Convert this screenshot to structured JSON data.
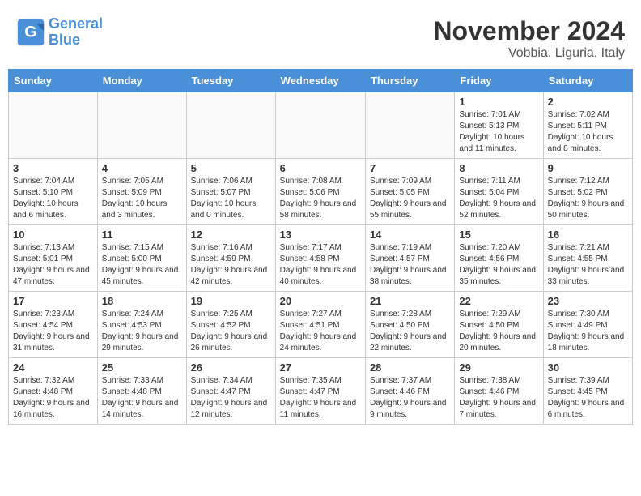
{
  "header": {
    "logo_line1": "General",
    "logo_line2": "Blue",
    "month_title": "November 2024",
    "location": "Vobbia, Liguria, Italy"
  },
  "days_of_week": [
    "Sunday",
    "Monday",
    "Tuesday",
    "Wednesday",
    "Thursday",
    "Friday",
    "Saturday"
  ],
  "weeks": [
    [
      {
        "day": "",
        "info": ""
      },
      {
        "day": "",
        "info": ""
      },
      {
        "day": "",
        "info": ""
      },
      {
        "day": "",
        "info": ""
      },
      {
        "day": "",
        "info": ""
      },
      {
        "day": "1",
        "info": "Sunrise: 7:01 AM\nSunset: 5:13 PM\nDaylight: 10 hours and 11 minutes."
      },
      {
        "day": "2",
        "info": "Sunrise: 7:02 AM\nSunset: 5:11 PM\nDaylight: 10 hours and 8 minutes."
      }
    ],
    [
      {
        "day": "3",
        "info": "Sunrise: 7:04 AM\nSunset: 5:10 PM\nDaylight: 10 hours and 6 minutes."
      },
      {
        "day": "4",
        "info": "Sunrise: 7:05 AM\nSunset: 5:09 PM\nDaylight: 10 hours and 3 minutes."
      },
      {
        "day": "5",
        "info": "Sunrise: 7:06 AM\nSunset: 5:07 PM\nDaylight: 10 hours and 0 minutes."
      },
      {
        "day": "6",
        "info": "Sunrise: 7:08 AM\nSunset: 5:06 PM\nDaylight: 9 hours and 58 minutes."
      },
      {
        "day": "7",
        "info": "Sunrise: 7:09 AM\nSunset: 5:05 PM\nDaylight: 9 hours and 55 minutes."
      },
      {
        "day": "8",
        "info": "Sunrise: 7:11 AM\nSunset: 5:04 PM\nDaylight: 9 hours and 52 minutes."
      },
      {
        "day": "9",
        "info": "Sunrise: 7:12 AM\nSunset: 5:02 PM\nDaylight: 9 hours and 50 minutes."
      }
    ],
    [
      {
        "day": "10",
        "info": "Sunrise: 7:13 AM\nSunset: 5:01 PM\nDaylight: 9 hours and 47 minutes."
      },
      {
        "day": "11",
        "info": "Sunrise: 7:15 AM\nSunset: 5:00 PM\nDaylight: 9 hours and 45 minutes."
      },
      {
        "day": "12",
        "info": "Sunrise: 7:16 AM\nSunset: 4:59 PM\nDaylight: 9 hours and 42 minutes."
      },
      {
        "day": "13",
        "info": "Sunrise: 7:17 AM\nSunset: 4:58 PM\nDaylight: 9 hours and 40 minutes."
      },
      {
        "day": "14",
        "info": "Sunrise: 7:19 AM\nSunset: 4:57 PM\nDaylight: 9 hours and 38 minutes."
      },
      {
        "day": "15",
        "info": "Sunrise: 7:20 AM\nSunset: 4:56 PM\nDaylight: 9 hours and 35 minutes."
      },
      {
        "day": "16",
        "info": "Sunrise: 7:21 AM\nSunset: 4:55 PM\nDaylight: 9 hours and 33 minutes."
      }
    ],
    [
      {
        "day": "17",
        "info": "Sunrise: 7:23 AM\nSunset: 4:54 PM\nDaylight: 9 hours and 31 minutes."
      },
      {
        "day": "18",
        "info": "Sunrise: 7:24 AM\nSunset: 4:53 PM\nDaylight: 9 hours and 29 minutes."
      },
      {
        "day": "19",
        "info": "Sunrise: 7:25 AM\nSunset: 4:52 PM\nDaylight: 9 hours and 26 minutes."
      },
      {
        "day": "20",
        "info": "Sunrise: 7:27 AM\nSunset: 4:51 PM\nDaylight: 9 hours and 24 minutes."
      },
      {
        "day": "21",
        "info": "Sunrise: 7:28 AM\nSunset: 4:50 PM\nDaylight: 9 hours and 22 minutes."
      },
      {
        "day": "22",
        "info": "Sunrise: 7:29 AM\nSunset: 4:50 PM\nDaylight: 9 hours and 20 minutes."
      },
      {
        "day": "23",
        "info": "Sunrise: 7:30 AM\nSunset: 4:49 PM\nDaylight: 9 hours and 18 minutes."
      }
    ],
    [
      {
        "day": "24",
        "info": "Sunrise: 7:32 AM\nSunset: 4:48 PM\nDaylight: 9 hours and 16 minutes."
      },
      {
        "day": "25",
        "info": "Sunrise: 7:33 AM\nSunset: 4:48 PM\nDaylight: 9 hours and 14 minutes."
      },
      {
        "day": "26",
        "info": "Sunrise: 7:34 AM\nSunset: 4:47 PM\nDaylight: 9 hours and 12 minutes."
      },
      {
        "day": "27",
        "info": "Sunrise: 7:35 AM\nSunset: 4:47 PM\nDaylight: 9 hours and 11 minutes."
      },
      {
        "day": "28",
        "info": "Sunrise: 7:37 AM\nSunset: 4:46 PM\nDaylight: 9 hours and 9 minutes."
      },
      {
        "day": "29",
        "info": "Sunrise: 7:38 AM\nSunset: 4:46 PM\nDaylight: 9 hours and 7 minutes."
      },
      {
        "day": "30",
        "info": "Sunrise: 7:39 AM\nSunset: 4:45 PM\nDaylight: 9 hours and 6 minutes."
      }
    ]
  ]
}
